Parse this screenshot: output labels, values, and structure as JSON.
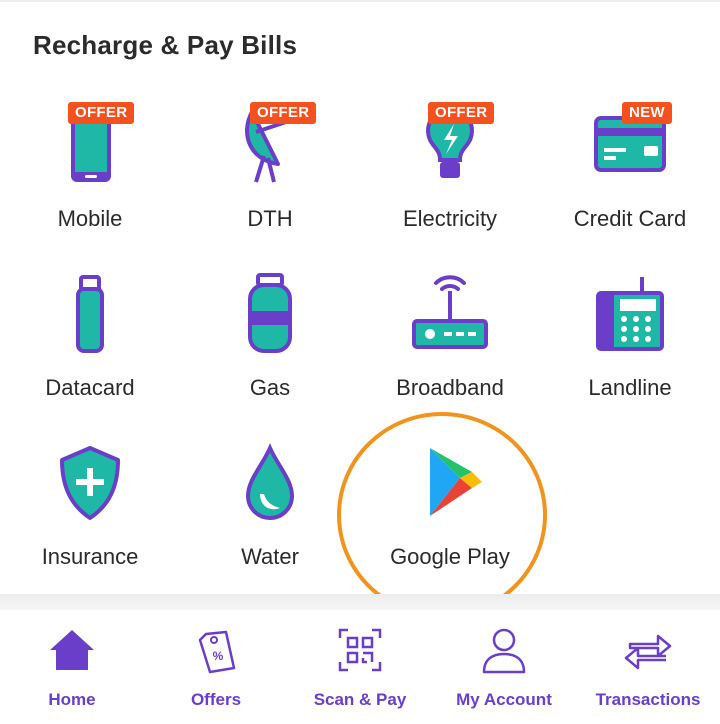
{
  "section": {
    "title": "Recharge & Pay Bills"
  },
  "tiles": [
    {
      "label": "Mobile",
      "badge": "OFFER",
      "icon": "mobile-icon"
    },
    {
      "label": "DTH",
      "badge": "OFFER",
      "icon": "dish-antenna-icon"
    },
    {
      "label": "Electricity",
      "badge": "OFFER",
      "icon": "bulb-icon"
    },
    {
      "label": "Credit Card",
      "badge": "NEW",
      "icon": "credit-card-icon"
    },
    {
      "label": "Datacard",
      "icon": "usb-stick-icon"
    },
    {
      "label": "Gas",
      "icon": "gas-cylinder-icon"
    },
    {
      "label": "Broadband",
      "icon": "router-icon"
    },
    {
      "label": "Landline",
      "icon": "telephone-icon"
    },
    {
      "label": "Insurance",
      "icon": "shield-plus-icon"
    },
    {
      "label": "Water",
      "icon": "water-drop-icon"
    },
    {
      "label": "Google Play",
      "icon": "google-play-icon"
    }
  ],
  "nav": [
    {
      "label": "Home",
      "icon": "home-icon"
    },
    {
      "label": "Offers",
      "icon": "offer-tag-icon"
    },
    {
      "label": "Scan & Pay",
      "icon": "qr-scan-icon"
    },
    {
      "label": "My Account",
      "icon": "user-icon"
    },
    {
      "label": "Transactions",
      "icon": "swap-arrows-icon"
    }
  ],
  "colors": {
    "purple": "#6a3ec8",
    "teal": "#1fb7a6",
    "badge": "#f4511e",
    "highlight": "#f0941c"
  }
}
